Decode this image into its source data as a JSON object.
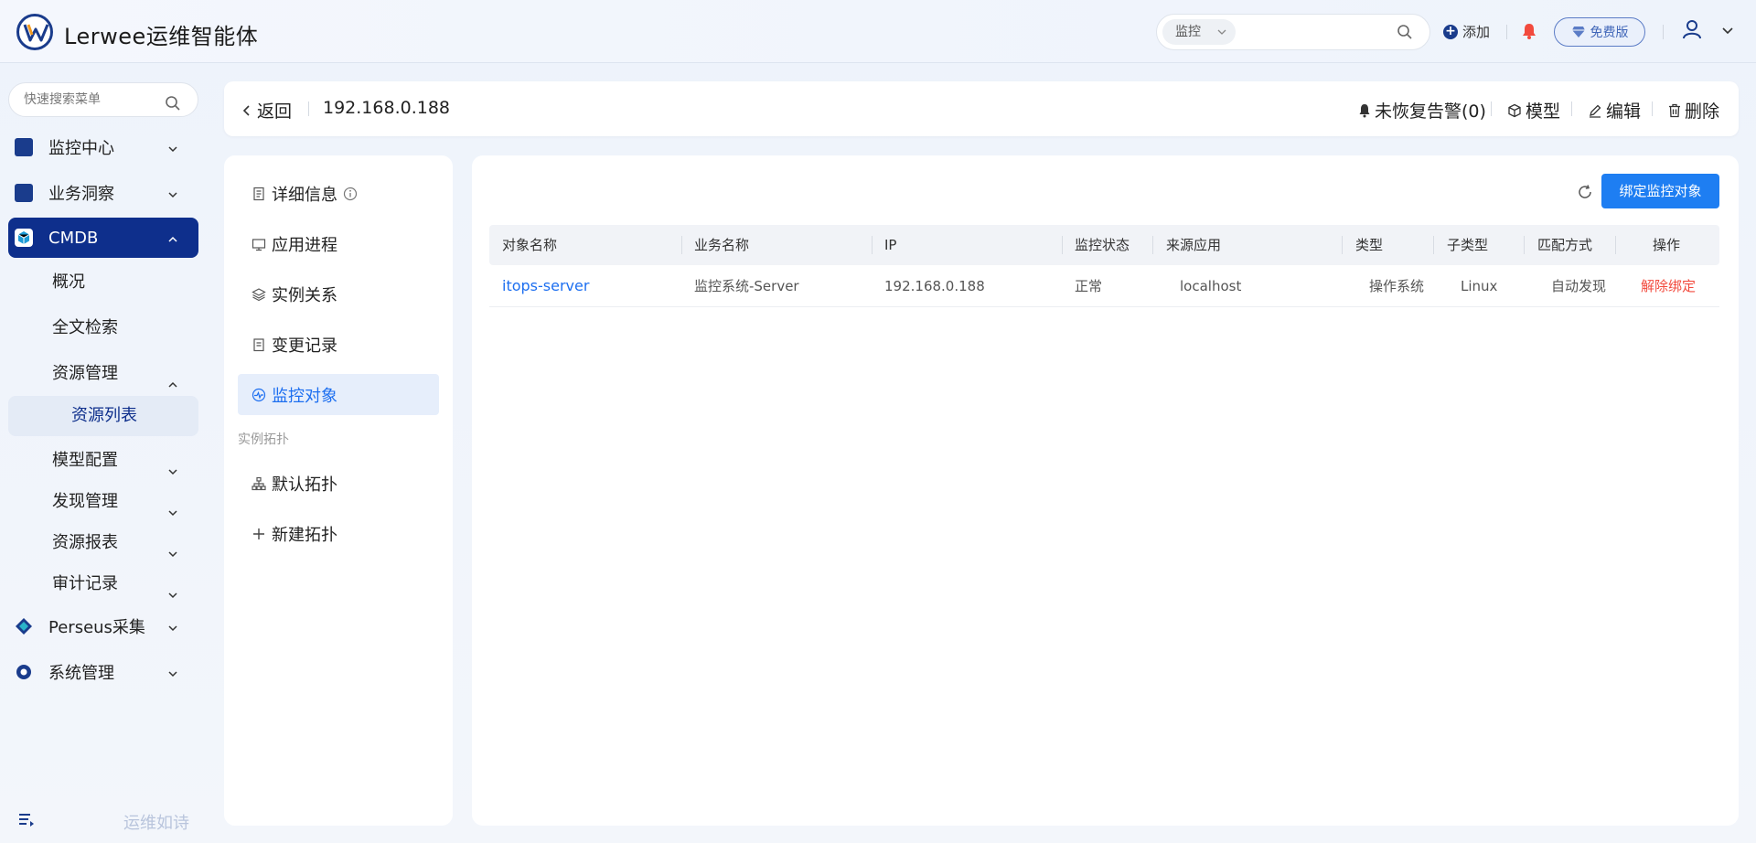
{
  "app": {
    "title": "Lerwee运维智能体"
  },
  "header": {
    "search_scope": "监控",
    "search_placeholder": "",
    "add_label": "添加",
    "free_badge": "免费版"
  },
  "sidebar": {
    "search_placeholder": "快速搜索菜单",
    "items": [
      {
        "label": "监控中心"
      },
      {
        "label": "业务洞察"
      },
      {
        "label": "CMDB"
      },
      {
        "label": "概况"
      },
      {
        "label": "全文检索"
      },
      {
        "label": "资源管理"
      },
      {
        "label": "资源列表"
      },
      {
        "label": "模型配置"
      },
      {
        "label": "发现管理"
      },
      {
        "label": "资源报表"
      },
      {
        "label": "审计记录"
      },
      {
        "label": "Perseus采集"
      },
      {
        "label": "系统管理"
      }
    ],
    "footer_text": "运维如诗"
  },
  "topbar": {
    "back_label": "返回",
    "ip": "192.168.0.188",
    "alarms_label": "未恢复告警(0)",
    "model_label": "模型",
    "edit_label": "编辑",
    "delete_label": "删除"
  },
  "detail_menu": {
    "items": [
      {
        "label": "详细信息"
      },
      {
        "label": "应用进程"
      },
      {
        "label": "实例关系"
      },
      {
        "label": "变更记录"
      },
      {
        "label": "监控对象"
      }
    ],
    "group_label": "实例拓扑",
    "topo_items": [
      {
        "label": "默认拓扑"
      },
      {
        "label": "新建拓扑"
      }
    ]
  },
  "main": {
    "bind_button": "绑定监控对象",
    "columns": [
      "对象名称",
      "业务名称",
      "IP",
      "监控状态",
      "来源应用",
      "类型",
      "子类型",
      "匹配方式",
      "操作"
    ],
    "rows": [
      {
        "name": "itops-server",
        "business": "监控系统-Server",
        "ip": "192.168.0.188",
        "status": "正常",
        "source": "localhost",
        "type": "操作系统",
        "subtype": "Linux",
        "match": "自动发现",
        "action": "解除绑定"
      }
    ]
  },
  "colors": {
    "primary": "#1e7ef2",
    "nav_active": "#0e2f8c",
    "danger": "#f24a3d",
    "link": "#1d6ff0"
  }
}
